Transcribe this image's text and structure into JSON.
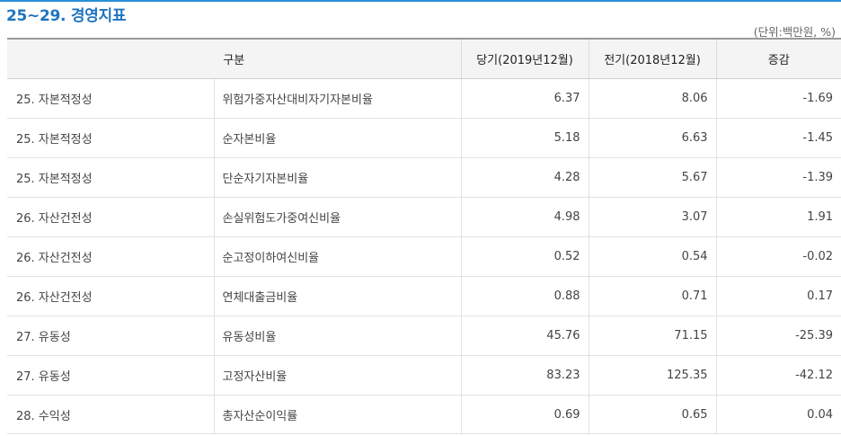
{
  "title": "25~29. 경영지표",
  "unit_note": "(단위:백만원, %)",
  "table": {
    "headers": [
      "구분",
      "당기(2019년12월)",
      "전기(2018년12월)",
      "증감"
    ],
    "rows": [
      {
        "category": "25. 자본적정성",
        "item": "위험가중자산대비자기자본비율",
        "current": "6.37",
        "previous": "8.06",
        "change": "-1.69"
      },
      {
        "category": "25. 자본적정성",
        "item": "순자본비율",
        "current": "5.18",
        "previous": "6.63",
        "change": "-1.45"
      },
      {
        "category": "25. 자본적정성",
        "item": "단순자기자본비율",
        "current": "4.28",
        "previous": "5.67",
        "change": "-1.39"
      },
      {
        "category": "26. 자산건전성",
        "item": "손실위험도가중여신비율",
        "current": "4.98",
        "previous": "3.07",
        "change": "1.91"
      },
      {
        "category": "26. 자산건전성",
        "item": "순고정이하여신비율",
        "current": "0.52",
        "previous": "0.54",
        "change": "-0.02"
      },
      {
        "category": "26. 자산건전성",
        "item": "연체대출금비율",
        "current": "0.88",
        "previous": "0.71",
        "change": "0.17"
      },
      {
        "category": "27. 유동성",
        "item": "유동성비율",
        "current": "45.76",
        "previous": "71.15",
        "change": "-25.39"
      },
      {
        "category": "27. 유동성",
        "item": "고정자산비율",
        "current": "83.23",
        "previous": "125.35",
        "change": "-42.12"
      },
      {
        "category": "28. 수익성",
        "item": "총자산순이익률",
        "current": "0.69",
        "previous": "0.65",
        "change": "0.04"
      }
    ]
  }
}
